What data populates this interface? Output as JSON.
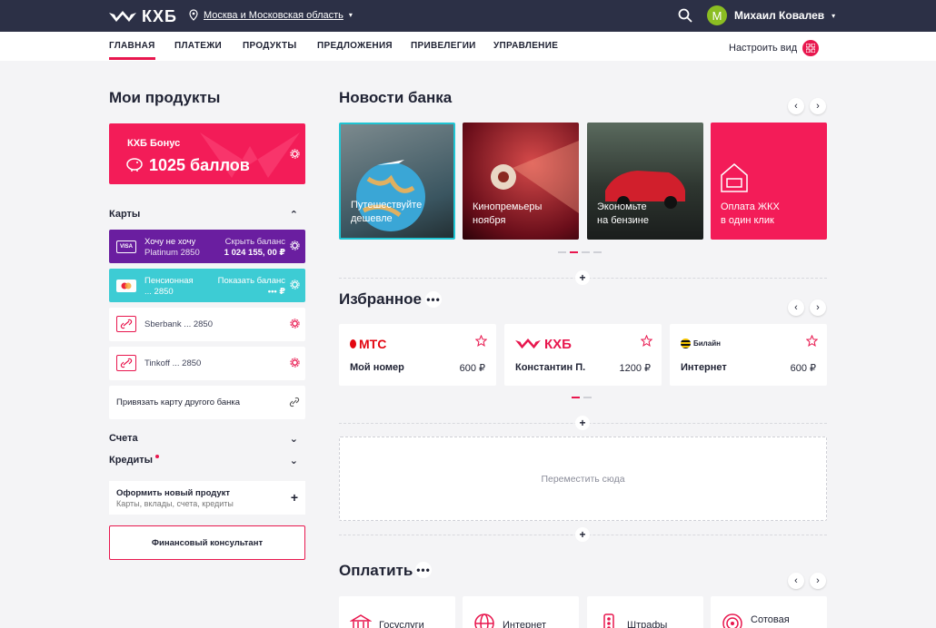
{
  "header": {
    "brand": "КХБ",
    "location": "Москва и Московская область",
    "user_initial": "М",
    "user_name": "Михаил Ковалев"
  },
  "nav": {
    "items": [
      "ГЛАВНАЯ",
      "ПЛАТЕЖИ",
      "ПРОДУКТЫ",
      "ПРЕДЛОЖЕНИЯ",
      "ПРИВЕЛЕГИИ",
      "УПРАВЛЕНИЕ"
    ],
    "customize": "Настроить вид"
  },
  "products": {
    "title": "Мои продукты",
    "bonus": {
      "title": "КХБ Бонус",
      "value": "1025 баллов"
    },
    "cards_title": "Карты",
    "cards": [
      {
        "name": "Хочу не хочу",
        "sub": "Platinum 2850",
        "balance_label": "Скрыть баланс",
        "balance": "1 024 155, 00 ₽",
        "chip": "VISA"
      },
      {
        "name": "Пенсионная",
        "sub": "... 2850",
        "balance_label": "Показать баланс",
        "balance": "••• ₽"
      },
      {
        "name": "Sberbank ... 2850"
      },
      {
        "name": "Tinkoff ... 2850"
      }
    ],
    "link_card": "Привязать карту другого банка",
    "accounts": "Счета",
    "credits": "Кредиты",
    "new_product": {
      "title": "Оформить новый продукт",
      "sub": "Карты, вклады, счета, кредиты"
    },
    "consultant": "Финансовый консультант"
  },
  "news": {
    "title": "Новости банка",
    "items": [
      {
        "l1": "Путешествуйте",
        "l2": "дешевле"
      },
      {
        "l1": "Кинопремьеры",
        "l2": "ноября"
      },
      {
        "l1": "Экономьте",
        "l2": "на бензине"
      },
      {
        "l1": "Оплата ЖКХ",
        "l2": "в один клик"
      }
    ]
  },
  "favorites": {
    "title": "Избранное",
    "items": [
      {
        "brand": "МТС",
        "label": "Мой номер",
        "amount": "600 ₽"
      },
      {
        "brand": "КХБ",
        "label": "Константин П.",
        "amount": "1200 ₽"
      },
      {
        "brand": "Билайн",
        "label": "Интернет",
        "amount": "600 ₽"
      }
    ]
  },
  "drop_zone": "Переместить сюда",
  "pay": {
    "title": "Оплатить",
    "items": [
      "Госуслуги",
      "Интернет",
      "Штрафы",
      "Сотовая"
    ]
  }
}
